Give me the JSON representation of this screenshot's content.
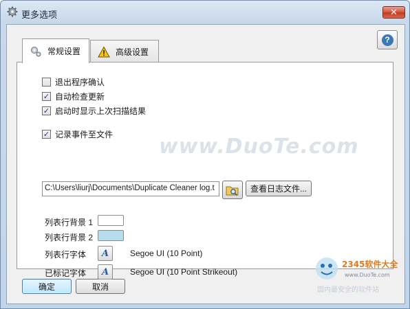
{
  "window": {
    "title": "更多选项",
    "close_label": "✕"
  },
  "help": {
    "label": "?"
  },
  "tabs": [
    {
      "label": "常规设置",
      "icon": "gear-icon",
      "active": true
    },
    {
      "label": "高级设置",
      "icon": "warning-icon",
      "active": false
    }
  ],
  "general": {
    "confirm_exit": {
      "label": "退出程序确认",
      "checked": false
    },
    "auto_update": {
      "label": "自动检查更新",
      "checked": true
    },
    "show_last_scan": {
      "label": "启动时显示上次扫描结果",
      "checked": true
    },
    "log_to_file": {
      "label": "记录事件至文件",
      "checked": true
    },
    "log_path": "C:\\Users\\liurj\\Documents\\Duplicate Cleaner log.t",
    "view_log_label": "查看日志文件...",
    "row_bg1_label": "列表行背景 1",
    "row_bg1_color": "#ffffff",
    "row_bg2_label": "列表行背景 2",
    "row_bg2_color": "#b7dcec",
    "list_font_label": "列表行字体",
    "list_font_value": "Segoe UI (10 Point)",
    "marked_font_label": "已标记字体",
    "marked_font_value": "Segoe UI (10 Point Strikeout)",
    "font_icon_glyph": "A"
  },
  "footer": {
    "ok_label": "确定",
    "cancel_label": "取消"
  },
  "watermark": {
    "text": "www.DuoTe.com",
    "logo_text": "2345软件大全",
    "logo_url": "www.DuoTe.com",
    "logo_tagline": "国内最安全的软件站"
  },
  "colors": {
    "accent": "#3a78b8",
    "title_bar": "#c9d9ea",
    "close": "#c3371f"
  }
}
